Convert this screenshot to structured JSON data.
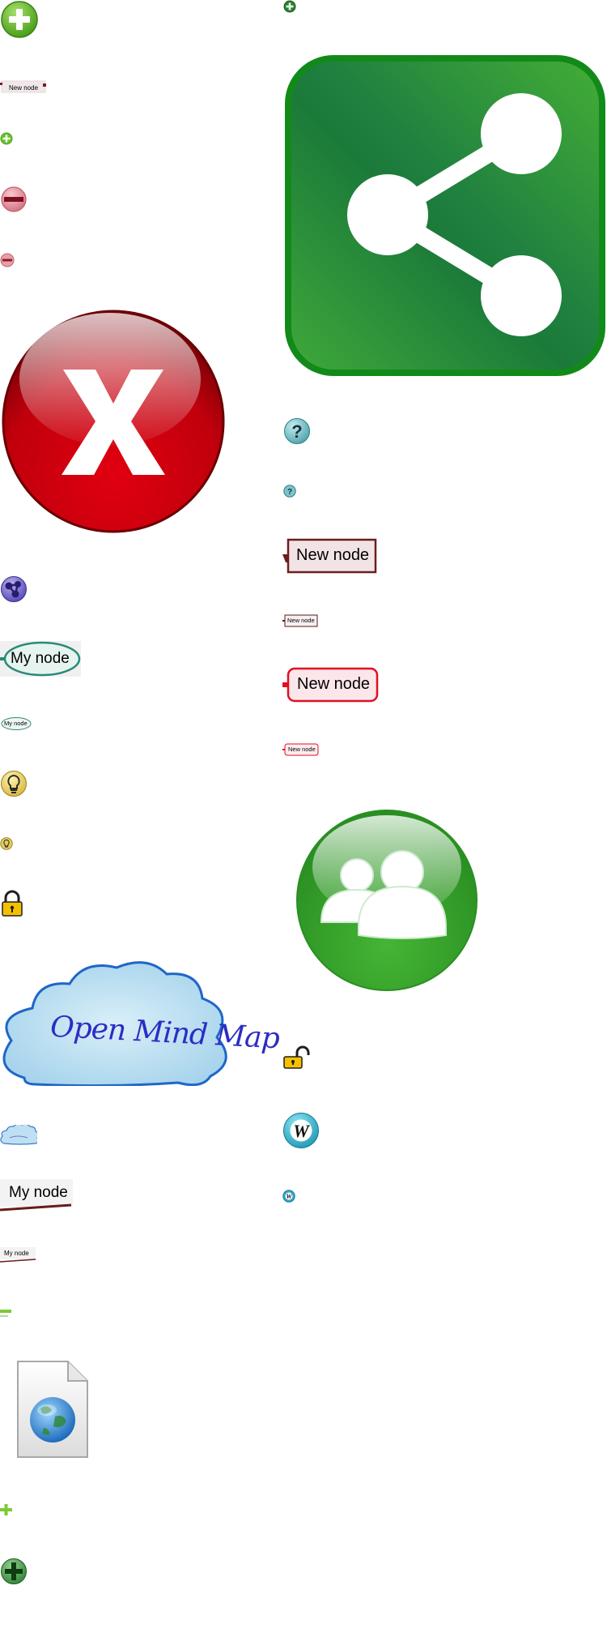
{
  "labels": {
    "new_node": "New node",
    "my_node": "My node",
    "cloud_text": "Open Mind Map",
    "w_letter": "W"
  },
  "icons": [
    "add-icon-large",
    "add-icon-tiny",
    "new-node-tag-tiny",
    "add-icon-small",
    "remove-icon",
    "remove-icon-small",
    "share-icon",
    "close-icon",
    "help-icon",
    "help-icon-small",
    "node-tag-dark",
    "node-tag-dark-small",
    "network-icon",
    "node-tag-red",
    "node-tag-red-small",
    "node-ellipse",
    "node-ellipse-small",
    "lightbulb-icon",
    "lightbulb-icon-small",
    "users-icon",
    "lock-icon",
    "unlock-icon",
    "cloud-node",
    "cloud-node-small",
    "wikipedia-icon",
    "wikipedia-icon-small",
    "node-underline",
    "node-underline-small",
    "collapse-icon-tiny",
    "web-document-icon",
    "expand-icon-tiny",
    "add-icon-dark"
  ],
  "colors": {
    "green": "#3aa830",
    "dark_green": "#1b7a39",
    "red": "#c8000c",
    "pink": "#e2a0a8",
    "blue": "#3c7cc8",
    "teal": "#2a9a8a",
    "yellow": "#f2c200",
    "cloud_fill": "#bfe0f2",
    "cloud_stroke": "#1f66c8"
  }
}
